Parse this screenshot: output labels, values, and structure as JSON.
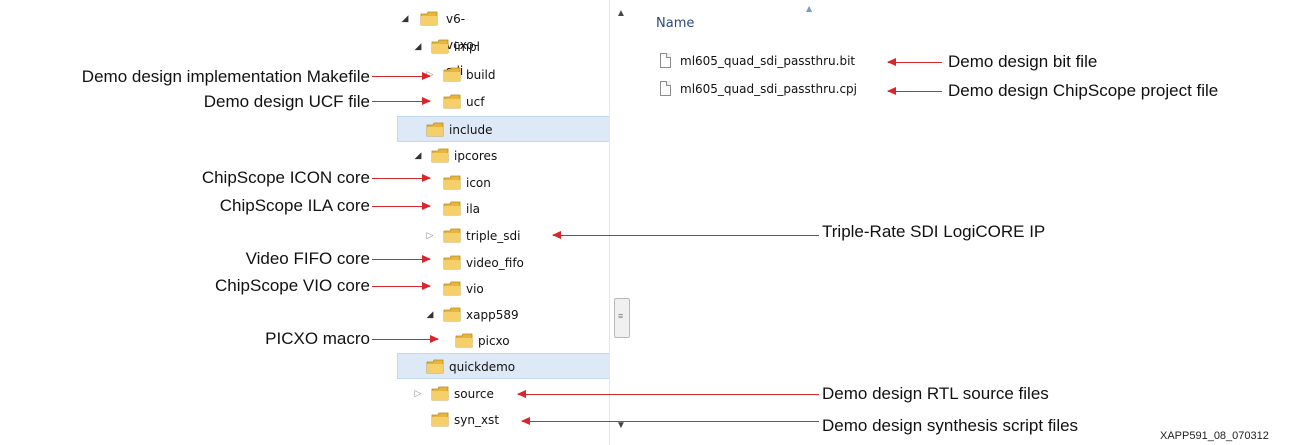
{
  "explorer": {
    "tree": [
      {
        "label": "v6-vcxo-sdi",
        "expanded": true
      },
      {
        "label": "impl",
        "expanded": true
      },
      {
        "label": "build",
        "expanded": false
      },
      {
        "label": "ucf"
      },
      {
        "label": "include"
      },
      {
        "label": "ipcores",
        "expanded": true
      },
      {
        "label": "icon"
      },
      {
        "label": "ila"
      },
      {
        "label": "triple_sdi",
        "expanded": false
      },
      {
        "label": "video_fifo"
      },
      {
        "label": "vio"
      },
      {
        "label": "xapp589",
        "expanded": true
      },
      {
        "label": "picxo"
      },
      {
        "label": "quickdemo",
        "selected": true
      },
      {
        "label": "source",
        "expanded": false
      },
      {
        "label": "syn_xst"
      }
    ],
    "file_list": {
      "column_header": "Name",
      "files": [
        {
          "name": "ml605_quad_sdi_passthru.bit"
        },
        {
          "name": "ml605_quad_sdi_passthru.cpj"
        }
      ]
    },
    "icons": {
      "folder": "folder-icon",
      "file": "file-icon",
      "expand": "expand-triangle-icon",
      "collapse": "collapse-triangle-icon"
    }
  },
  "annotations": {
    "left": [
      {
        "text": "Demo design implementation Makefile"
      },
      {
        "text": "Demo design UCF file"
      },
      {
        "text": "ChipScope ICON core"
      },
      {
        "text": "ChipScope ILA core"
      },
      {
        "text": "Video FIFO core"
      },
      {
        "text": "ChipScope VIO core"
      },
      {
        "text": "PICXO macro"
      }
    ],
    "right": [
      {
        "text": "Demo design bit file"
      },
      {
        "text": "Demo design ChipScope project file"
      },
      {
        "text": "Triple-Rate SDI LogiCORE IP"
      },
      {
        "text": "Demo design RTL source files"
      },
      {
        "text": "Demo design synthesis script files"
      }
    ]
  },
  "figure_id": "XAPP591_08_070312",
  "colors": {
    "arrow": "#d9262a",
    "selection": "#dde9f7",
    "folder": "#e8b53c"
  }
}
